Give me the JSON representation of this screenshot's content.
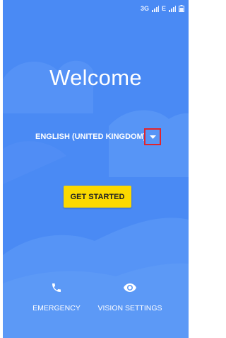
{
  "status_bar": {
    "network_1": "3G",
    "network_2": "E",
    "signal_icon": "cell-signal-icon",
    "battery_icon": "battery-icon"
  },
  "welcome": {
    "title": "Welcome"
  },
  "language": {
    "selected": "ENGLISH (UNITED KINGDOM)",
    "dropdown_icon": "dropdown-arrow-icon"
  },
  "actions": {
    "get_started_label": "GET STARTED",
    "emergency_label": "EMERGENCY",
    "emergency_icon": "phone-icon",
    "vision_settings_label": "VISION SETTINGS",
    "vision_icon": "eye-icon"
  },
  "colors": {
    "background": "#4a8af4",
    "button": "#fbd900",
    "highlight": "#e1242c"
  }
}
